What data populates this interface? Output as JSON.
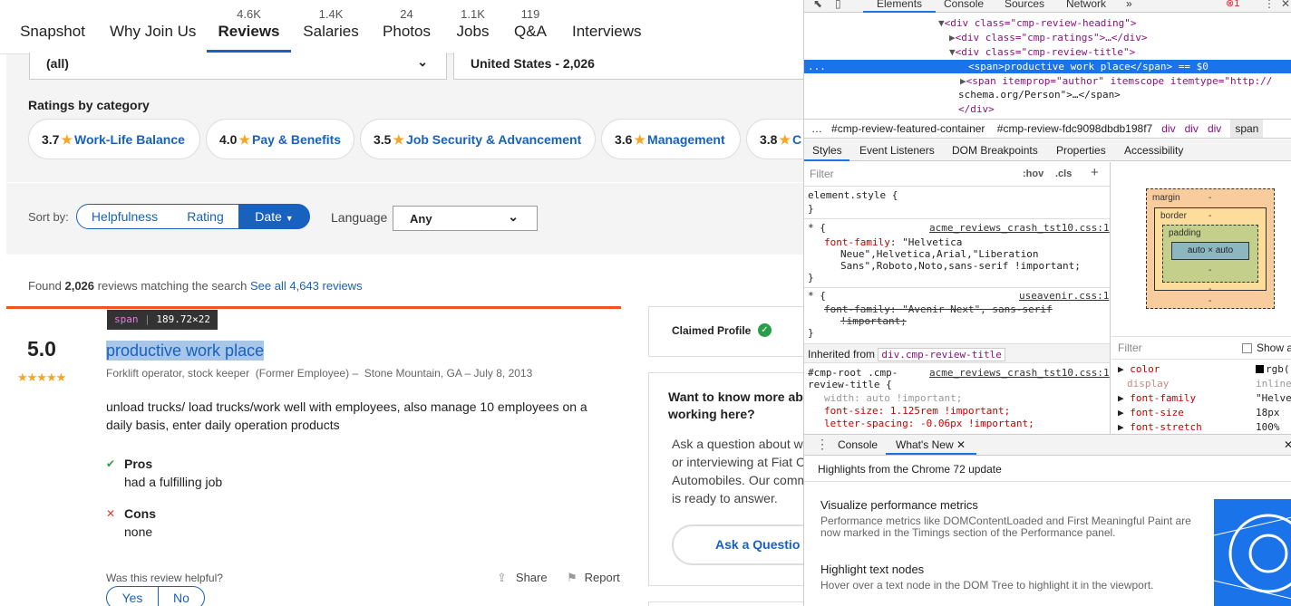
{
  "nav": {
    "tabs": [
      {
        "label": "Snapshot",
        "count": ""
      },
      {
        "label": "Why Join Us",
        "count": ""
      },
      {
        "label": "Reviews",
        "count": "4.6K"
      },
      {
        "label": "Salaries",
        "count": "1.4K"
      },
      {
        "label": "Photos",
        "count": "24"
      },
      {
        "label": "Jobs",
        "count": "1.1K"
      },
      {
        "label": "Q&A",
        "count": "119"
      },
      {
        "label": "Interviews",
        "count": ""
      }
    ]
  },
  "filters": {
    "job_title": "(all)",
    "location": "United States - 2,026"
  },
  "ratings": {
    "heading": "Ratings by category",
    "categories": [
      {
        "score": "3.7",
        "label": "Work-Life Balance"
      },
      {
        "score": "4.0",
        "label": "Pay & Benefits"
      },
      {
        "score": "3.5",
        "label": "Job Security & Advancement"
      },
      {
        "score": "3.6",
        "label": "Management"
      },
      {
        "score": "3.8",
        "label": "C"
      }
    ]
  },
  "sort": {
    "label": "Sort by:",
    "helpfulness": "Helpfulness",
    "rating": "Rating",
    "date": "Date",
    "language_label": "Language",
    "language_value": "Any"
  },
  "found": {
    "prefix": "Found ",
    "count": "2,026",
    "suffix": " reviews matching the search ",
    "see_all": "See all 4,643 reviews"
  },
  "review": {
    "tooltip_tag": "span",
    "tooltip_size": "189.72×22",
    "rating": "5.0",
    "stars": "★★★★★",
    "title": "productive work place",
    "author": "Forklift operator, stock keeper",
    "employment": "(Former Employee)",
    "location": "Stone Mountain, GA",
    "date": "July 8, 2013",
    "body": "unload trucks/ load trucks/work well with employees, also manage 10 employees on a daily basis, enter daily operation products",
    "pros_label": "Pros",
    "pros": "had a fulfilling job",
    "cons_label": "Cons",
    "cons": "none",
    "helpful_q": "Was this review helpful?",
    "yes": "Yes",
    "no": "No",
    "share": "Share",
    "report": "Report"
  },
  "sidebar": {
    "claimed": "Claimed Profile",
    "want_title_1": "Want to know more ab",
    "want_title_2": "working here?",
    "ask_text": [
      "Ask a question about w",
      "or interviewing at Fiat C",
      "Automobiles. Our comm",
      "is ready to answer."
    ],
    "ask_button": "Ask a Questio"
  },
  "devtools": {
    "tabs": [
      "Elements",
      "Console",
      "Sources",
      "Network",
      "»"
    ],
    "errors": "1",
    "dom": [
      {
        "indent": 0,
        "arrow": "▼",
        "html": "<div class=\"cmp-review-heading\">"
      },
      {
        "indent": 1,
        "arrow": "▶",
        "html": "<div class=\"cmp-ratings\">…</div>"
      },
      {
        "indent": 1,
        "arrow": "▼",
        "html": "<div class=\"cmp-review-title\">"
      },
      {
        "indent": 2,
        "arrow": "",
        "html": "<span>productive work place</span> == $0"
      },
      {
        "indent": 2,
        "arrow": "▶",
        "html": "<span itemprop=\"author\" itemscope itemtype=\"http://"
      },
      {
        "indent": 0,
        "arrow": "",
        "html": "schema.org/Person\">…</span>"
      },
      {
        "indent": 1,
        "arrow": "",
        "html": "</div>"
      }
    ],
    "breadcrumbs": [
      "…",
      "#cmp-review-featured-container",
      "#cmp-review-fdc9098dbdb198f7",
      "div",
      "div",
      "div",
      "span"
    ],
    "panel_tabs": [
      "Styles",
      "Event Listeners",
      "DOM Breakpoints",
      "Properties",
      "Accessibility"
    ],
    "filter_placeholder": "Filter",
    "hov": ":hov",
    "cls": ".cls",
    "styles": {
      "element_style": "element.style {",
      "rule1_selector": "* {",
      "rule1_source": "acme_reviews_crash_tst10.css:1",
      "rule1_prop": "font-family",
      "rule1_val_1": "\"Helvetica",
      "rule1_val_2": "Neue\",Helvetica,Arial,\"Liberation",
      "rule1_val_3": "Sans\",Roboto,Noto,sans-serif !important;",
      "rule2_selector": "* {",
      "rule2_source": "useavenir.css:1",
      "rule2_line1": "font-family: \"Avenir Next\", sans-serif",
      "rule2_line2": "!important;",
      "inherited_label": "Inherited from ",
      "inherited_from": "div.cmp-review-title",
      "rule3_selector_1": "#cmp-root .cmp-",
      "rule3_selector_2": "review-title {",
      "rule3_source": "acme_reviews_crash_tst10.css:1",
      "rule3_line1": "width: auto !important;",
      "rule3_line2": "font-size: 1.125rem !important;",
      "rule3_line3": "letter-spacing: -0.06px !important;"
    },
    "boxmodel": {
      "margin": "margin",
      "border": "border",
      "padding": "padding",
      "content": "auto × auto",
      "dash": "-"
    },
    "computed_filter": "Filter",
    "show_all": "Show a",
    "computed": [
      {
        "prop": "color",
        "val": "rgb("
      },
      {
        "prop": "display",
        "val": "inline"
      },
      {
        "prop": "font-family",
        "val": "\"Helve"
      },
      {
        "prop": "font-size",
        "val": "18px"
      },
      {
        "prop": "font-stretch",
        "val": "100%"
      }
    ],
    "drawer_tabs": [
      "Console",
      "What's New"
    ],
    "whatsnew_header": "Highlights from the Chrome 72 update",
    "items": [
      {
        "title": "Visualize performance metrics",
        "desc": "Performance metrics like DOMContentLoaded and First Meaningful Paint are now marked in the Timings section of the Performance panel."
      },
      {
        "title": "Highlight text nodes",
        "desc": "Hover over a text node in the DOM Tree to highlight it in the viewport."
      }
    ]
  }
}
